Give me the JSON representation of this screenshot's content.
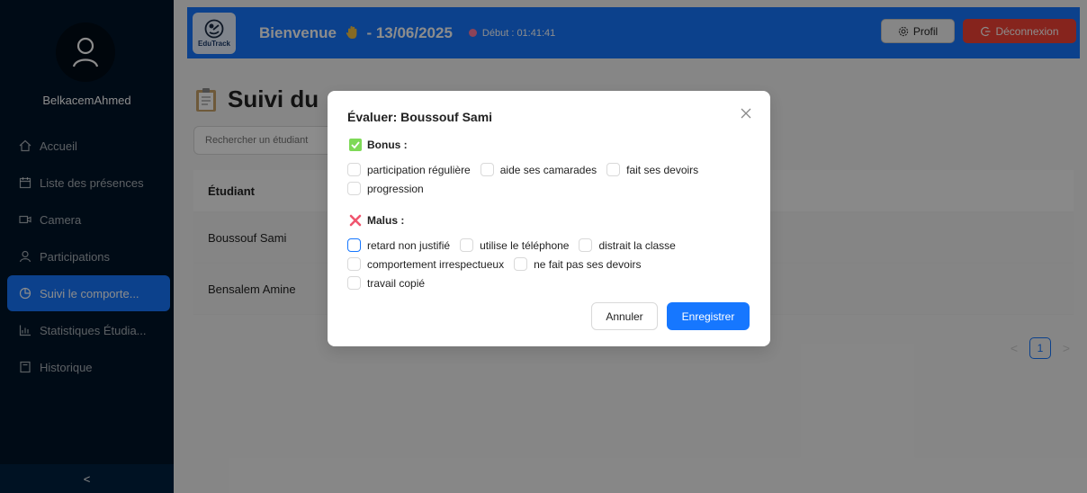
{
  "sidebar": {
    "username": "BelkacemAhmed",
    "items": [
      {
        "label": "Accueil",
        "icon": "home-icon"
      },
      {
        "label": "Liste des présences",
        "icon": "calendar-icon"
      },
      {
        "label": "Camera",
        "icon": "camera-icon"
      },
      {
        "label": "Participations",
        "icon": "user-icon"
      },
      {
        "label": "Suivi le comporte...",
        "icon": "pie-chart-icon",
        "active": true
      },
      {
        "label": "Statistiques Étudia...",
        "icon": "bar-chart-icon"
      },
      {
        "label": "Historique",
        "icon": "document-icon"
      }
    ],
    "collapse_glyph": "<"
  },
  "header": {
    "logo_text": "EduTrack",
    "welcome": "Bienvenue",
    "date": "- 13/06/2025",
    "start": "Début : 01:41:41",
    "profile_label": "Profil",
    "logout_label": "Déconnexion",
    "color": "#1677ff",
    "logout_color": "#f44336"
  },
  "main": {
    "title": "Suivi du",
    "search_placeholder": "Rechercher un étudiant",
    "table": {
      "header": "Étudiant",
      "rows": [
        "Boussouf Sami",
        "Bensalem Amine"
      ]
    },
    "pagination": {
      "prev": "<",
      "page": "1",
      "next": ">"
    }
  },
  "modal": {
    "title": "Évaluer: Boussouf Sami",
    "close_glyph": "×",
    "bonus": {
      "title": "Bonus :",
      "options": [
        "participation régulière",
        "aide ses camarades",
        "fait ses devoirs",
        "progression"
      ]
    },
    "malus": {
      "title": "Malus :",
      "options": [
        "retard non justifié",
        "utilise le téléphone",
        "distrait la classe",
        "comportement irrespectueux",
        "ne fait pas ses devoirs",
        "travail copié"
      ]
    },
    "cancel_label": "Annuler",
    "save_label": "Enregistrer"
  }
}
